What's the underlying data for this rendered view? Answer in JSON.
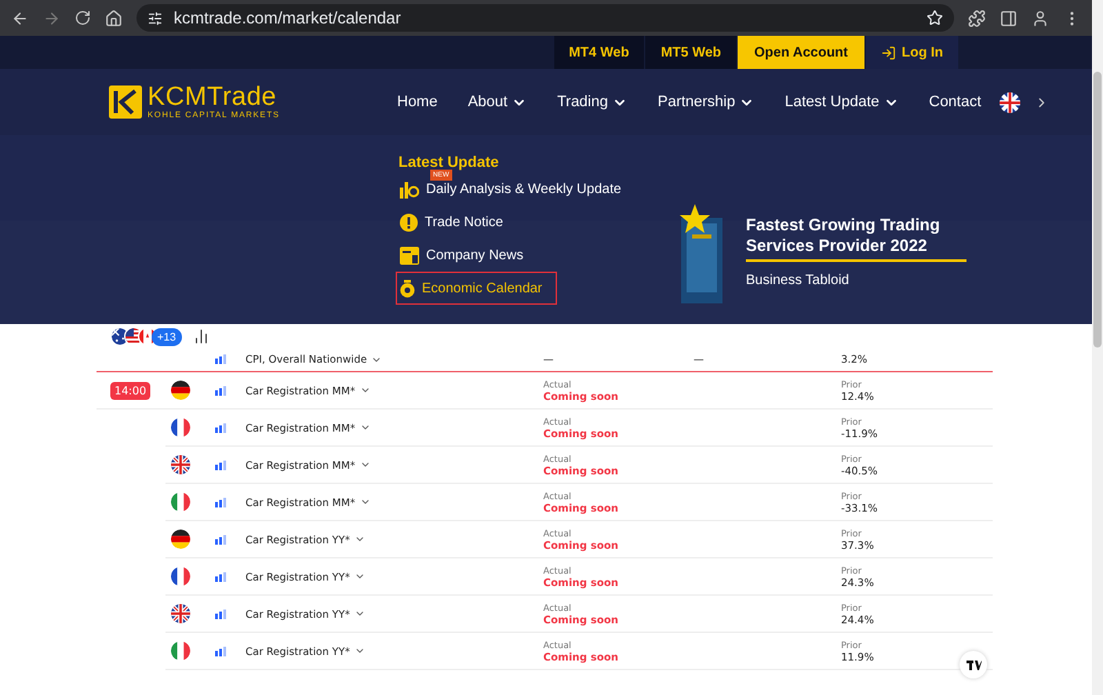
{
  "browser": {
    "url": "kcmtrade.com/market/calendar"
  },
  "top_links": [
    {
      "label": "MT4 Web",
      "kind": "dark"
    },
    {
      "label": "MT5 Web",
      "kind": "dark"
    },
    {
      "label": "Open Account",
      "kind": "accent"
    },
    {
      "label": "Log In",
      "kind": "login"
    }
  ],
  "logo": {
    "name": "KCMTrade",
    "tagline": "KOHLE CAPITAL MARKETS"
  },
  "nav": [
    {
      "label": "Home",
      "has_menu": false
    },
    {
      "label": "About",
      "has_menu": true
    },
    {
      "label": "Trading",
      "has_menu": true
    },
    {
      "label": "Partnership",
      "has_menu": true
    },
    {
      "label": "Latest Update",
      "has_menu": true
    },
    {
      "label": "Contact",
      "has_menu": false
    }
  ],
  "mega_menu": {
    "title": "Latest Update",
    "items": [
      {
        "label": "Daily Analysis & Weekly Update",
        "kind": "analysis",
        "badge": "NEW",
        "selected": false
      },
      {
        "label": "Trade Notice",
        "kind": "notice",
        "selected": false
      },
      {
        "label": "Company News",
        "kind": "news",
        "selected": false
      },
      {
        "label": "Economic Calendar",
        "kind": "calendar",
        "selected": true
      }
    ],
    "award": {
      "title": "Fastest Growing Trading Services Provider 2022",
      "source": "Business Tabloid"
    }
  },
  "filter": {
    "countries": [
      {
        "kind": "au"
      },
      {
        "kind": "us"
      },
      {
        "kind": "ca"
      }
    ],
    "more": "+13"
  },
  "rows": [
    {
      "event": "CPI, Overall Nationwide",
      "actual": "—",
      "forecast": "—",
      "prior": "3.2%",
      "now_line": true
    },
    {
      "time": "14:00",
      "kind": "de",
      "event": "Car Registration MM*",
      "actual_label": "Actual",
      "actual": "Coming soon",
      "prior_label": "Prior",
      "prior": "12.4%",
      "now_line": false
    },
    {
      "kind": "fr",
      "event": "Car Registration MM*",
      "actual_label": "Actual",
      "actual": "Coming soon",
      "prior_label": "Prior",
      "prior": "-11.9%",
      "now_line": false
    },
    {
      "kind": "gb",
      "event": "Car Registration MM*",
      "actual_label": "Actual",
      "actual": "Coming soon",
      "prior_label": "Prior",
      "prior": "-40.5%",
      "now_line": false
    },
    {
      "kind": "it",
      "event": "Car Registration MM*",
      "actual_label": "Actual",
      "actual": "Coming soon",
      "prior_label": "Prior",
      "prior": "-33.1%",
      "now_line": false
    },
    {
      "kind": "de",
      "event": "Car Registration YY*",
      "actual_label": "Actual",
      "actual": "Coming soon",
      "prior_label": "Prior",
      "prior": "37.3%",
      "now_line": false
    },
    {
      "kind": "fr",
      "event": "Car Registration YY*",
      "actual_label": "Actual",
      "actual": "Coming soon",
      "prior_label": "Prior",
      "prior": "24.3%",
      "now_line": false
    },
    {
      "kind": "gb",
      "event": "Car Registration YY*",
      "actual_label": "Actual",
      "actual": "Coming soon",
      "prior_label": "Prior",
      "prior": "24.4%",
      "now_line": false
    },
    {
      "kind": "it",
      "event": "Car Registration YY*",
      "actual_label": "Actual",
      "actual": "Coming soon",
      "prior_label": "Prior",
      "prior": "11.9%",
      "now_line": false
    }
  ]
}
